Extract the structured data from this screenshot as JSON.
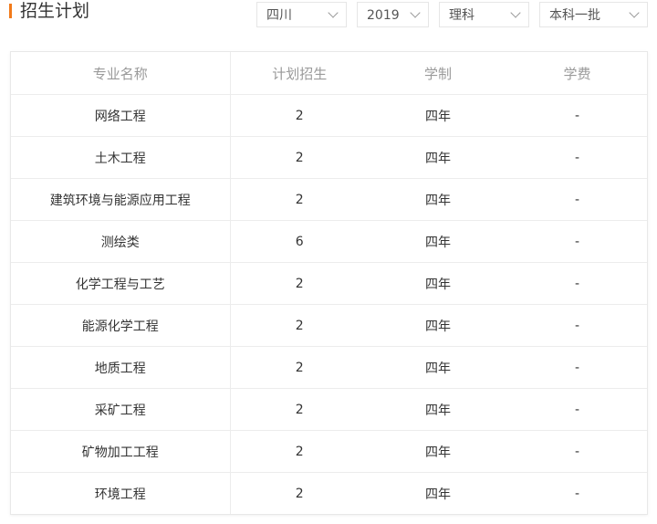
{
  "header": {
    "title": "招生计划",
    "filters": [
      {
        "value": "四川",
        "icon": "chevron-down-icon"
      },
      {
        "value": "2019",
        "icon": "chevron-down-icon"
      },
      {
        "value": "理科",
        "icon": "chevron-down-icon"
      },
      {
        "value": "本科一批",
        "icon": "chevron-down-icon"
      }
    ],
    "accent_color": "#f27a1a"
  },
  "table": {
    "columns": [
      "专业名称",
      "计划招生",
      "学制",
      "学费"
    ],
    "rows": [
      [
        "网络工程",
        "2",
        "四年",
        "-"
      ],
      [
        "土木工程",
        "2",
        "四年",
        "-"
      ],
      [
        "建筑环境与能源应用工程",
        "2",
        "四年",
        "-"
      ],
      [
        "测绘类",
        "6",
        "四年",
        "-"
      ],
      [
        "化学工程与工艺",
        "2",
        "四年",
        "-"
      ],
      [
        "能源化学工程",
        "2",
        "四年",
        "-"
      ],
      [
        "地质工程",
        "2",
        "四年",
        "-"
      ],
      [
        "采矿工程",
        "2",
        "四年",
        "-"
      ],
      [
        "矿物加工工程",
        "2",
        "四年",
        "-"
      ],
      [
        "环境工程",
        "2",
        "四年",
        "-"
      ]
    ]
  }
}
